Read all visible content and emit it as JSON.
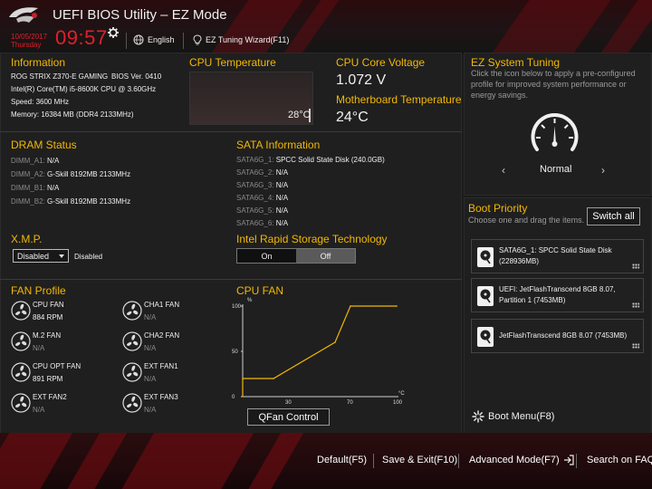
{
  "header": {
    "title": "UEFI BIOS Utility – EZ Mode",
    "date": "10/05/2017",
    "day": "Thursday",
    "time": "09:57",
    "language": "English",
    "tuning_wizard": "EZ Tuning Wizard(F11)"
  },
  "information": {
    "title": "Information",
    "board": "ROG STRIX Z370-E GAMING",
    "bios": "BIOS Ver. 0410",
    "cpu": "Intel(R) Core(TM) i5-8600K CPU @ 3.60GHz",
    "speed": "Speed: 3600 MHz",
    "memory": "Memory: 16384 MB (DDR4 2133MHz)"
  },
  "cpu_temperature": {
    "title": "CPU Temperature",
    "value": "28°C",
    "level_fraction": 0.28
  },
  "cpu_core_voltage": {
    "title": "CPU Core Voltage",
    "value": "1.072 V"
  },
  "motherboard_temperature": {
    "title": "Motherboard Temperature",
    "value": "24°C"
  },
  "dram": {
    "title": "DRAM Status",
    "slots": [
      {
        "name": "DIMM_A1:",
        "value": "N/A"
      },
      {
        "name": "DIMM_A2:",
        "value": "G-Skill 8192MB 2133MHz"
      },
      {
        "name": "DIMM_B1:",
        "value": "N/A"
      },
      {
        "name": "DIMM_B2:",
        "value": "G-Skill 8192MB 2133MHz"
      }
    ]
  },
  "sata": {
    "title": "SATA Information",
    "ports": [
      {
        "name": "SATA6G_1:",
        "value": "SPCC Solid State Disk (240.0GB)"
      },
      {
        "name": "SATA6G_2:",
        "value": "N/A"
      },
      {
        "name": "SATA6G_3:",
        "value": "N/A"
      },
      {
        "name": "SATA6G_4:",
        "value": "N/A"
      },
      {
        "name": "SATA6G_5:",
        "value": "N/A"
      },
      {
        "name": "SATA6G_6:",
        "value": "N/A"
      }
    ]
  },
  "xmp": {
    "title": "X.M.P.",
    "selected": "Disabled",
    "status": "Disabled"
  },
  "rst": {
    "title": "Intel Rapid Storage Technology",
    "on_label": "On",
    "off_label": "Off",
    "state": "Off"
  },
  "fan_profile": {
    "title": "FAN Profile",
    "fans": [
      {
        "name": "CPU FAN",
        "value": "884 RPM"
      },
      {
        "name": "CHA1 FAN",
        "value": "N/A"
      },
      {
        "name": "M.2 FAN",
        "value": "N/A"
      },
      {
        "name": "CHA2 FAN",
        "value": "N/A"
      },
      {
        "name": "CPU OPT FAN",
        "value": "891 RPM"
      },
      {
        "name": "EXT FAN1",
        "value": "N/A"
      },
      {
        "name": "EXT FAN2",
        "value": "N/A"
      },
      {
        "name": "EXT FAN3",
        "value": "N/A"
      }
    ]
  },
  "cpu_fan": {
    "title": "CPU FAN",
    "y_unit": "%",
    "x_unit": "°C",
    "y_ticks": [
      "100",
      "50",
      "0"
    ],
    "x_ticks": [
      "30",
      "70",
      "100"
    ],
    "qfan_label": "QFan Control"
  },
  "chart_data": {
    "type": "line",
    "title": "CPU FAN",
    "xlabel": "°C",
    "ylabel": "%",
    "xlim": [
      0,
      100
    ],
    "ylim": [
      0,
      100
    ],
    "series": [
      {
        "x": [
          0,
          20,
          60,
          70,
          100
        ],
        "y": [
          20,
          20,
          60,
          100,
          100
        ]
      }
    ],
    "color": "#f2b705"
  },
  "ez_tuning": {
    "title": "EZ System Tuning",
    "description": "Click the icon below to apply a pre-configured profile for improved system performance or energy savings.",
    "profile": "Normal",
    "prev": "‹",
    "next": "›"
  },
  "boot_priority": {
    "title": "Boot Priority",
    "hint": "Choose one and drag the items.",
    "switch_all": "Switch all",
    "items": [
      {
        "line1": "SATA6G_1: SPCC Solid State Disk",
        "line2": "(228936MB)"
      },
      {
        "line1": "UEFI: JetFlashTranscend 8GB 8.07,",
        "line2": "Partition 1 (7453MB)"
      },
      {
        "line1": "JetFlashTranscend 8GB 8.07  (7453MB)",
        "line2": ""
      }
    ]
  },
  "boot_menu": "Boot Menu(F8)",
  "footer": {
    "default": "Default(F5)",
    "save_exit": "Save & Exit(F10)",
    "advanced": "Advanced Mode(F7)",
    "search": "Search on FAQ"
  },
  "colors": {
    "accent": "#f2b705",
    "clock": "#e0202a",
    "background": "#1b1b1b"
  }
}
